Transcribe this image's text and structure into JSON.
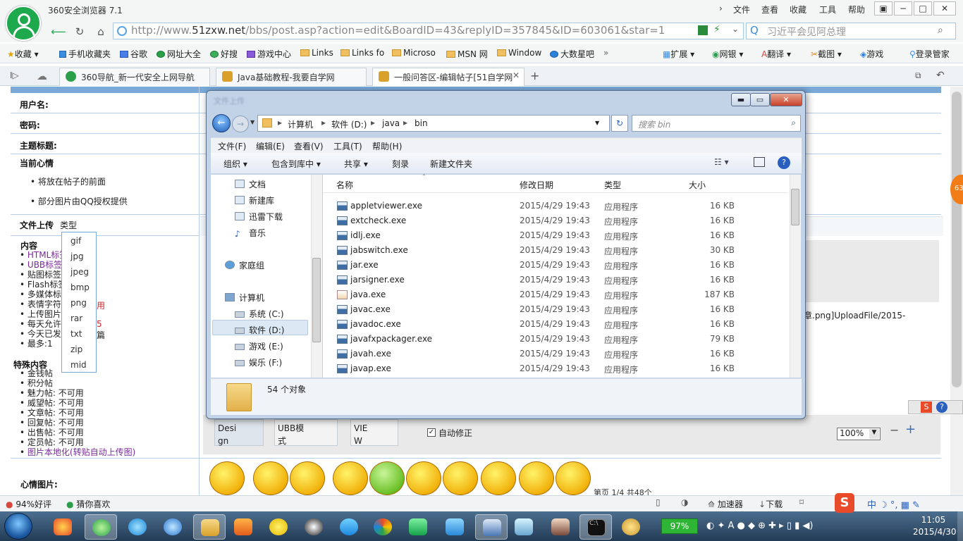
{
  "browser": {
    "title": "360安全浏览器 7.1",
    "menu": [
      "文件",
      "查看",
      "收藏",
      "工具",
      "帮助"
    ],
    "url_prefix": "http://www.",
    "url_domain": "51zxw.net",
    "url_rest": "/bbs/post.asp?action=edit&BoardID=43&replyID=357845&ID=603061&star=1",
    "search_text": "习近平会见阿总理",
    "bookmarks": [
      "收藏",
      "手机收藏夹",
      "谷歌",
      "网址大全",
      "好搜",
      "游戏中心",
      "Links",
      "Links fo",
      "Microso",
      "MSN 网",
      "Window",
      "大数星吧"
    ],
    "tools": [
      "扩展",
      "网银",
      "翻译",
      "截图",
      "游戏",
      "登录管家"
    ],
    "tabs": [
      {
        "label": "360导航_新一代安全上网导航"
      },
      {
        "label": "Java基础教程-我要自学网"
      },
      {
        "label": "一般问答区-编辑帖子[51自学网"
      }
    ]
  },
  "form": {
    "username_label": "用户名:",
    "password_label": "密码:",
    "subject_label": "主题标题:",
    "mood_label": "当前心情",
    "mood_items": [
      "将放在帖子的前面",
      "部分图片由QQ授权提供"
    ],
    "upload_label": "文件上传",
    "upload_type_label": "类型",
    "content_label": "内容",
    "content_items": [
      "HTML标签",
      "UBB标签",
      "贴图标签",
      "Flash标签",
      "多媒体标",
      "表情字符",
      "上传图片",
      "每天允许",
      "今天已发",
      "最多:1"
    ],
    "content_red": "用",
    "content_red2": "5",
    "content_side": "篇",
    "special_label": "特殊内容",
    "special_items": [
      "金钱帖",
      "积分帖",
      "魅力帖: 不可用",
      "威望帖: 不可用",
      "文章帖: 不可用",
      "回复帖: 不可用",
      "出售帖: 不可用",
      "定员帖: 不可用"
    ],
    "special_link": "图片本地化(转贴自动上传图)",
    "mood_pic_label": "心情图片:",
    "upload_text": "章.png]UploadFile/2015-",
    "editor_tabs": [
      "Desi\ngn",
      "UBB模\n式",
      "VIE\nW"
    ],
    "autofix_label": "自动修正",
    "zoom_value": "100%",
    "pager_text": "第页 1/4 共48个"
  },
  "dropdown": {
    "options": [
      "gif",
      "jpg",
      "jpeg",
      "bmp",
      "png",
      "rar",
      "txt",
      "zip",
      "mid"
    ]
  },
  "explorer": {
    "blurred_title": "文件上传",
    "breadcrumb": [
      "计算机",
      "软件 (D:)",
      "java",
      "bin"
    ],
    "search_placeholder": "搜索 bin",
    "menu": [
      "文件(F)",
      "编辑(E)",
      "查看(V)",
      "工具(T)",
      "帮助(H)"
    ],
    "toolbar": [
      "组织",
      "包含到库中",
      "共享",
      "刻录",
      "新建文件夹"
    ],
    "nav": [
      {
        "label": "文档",
        "group": "lib"
      },
      {
        "label": "新建库",
        "group": "lib"
      },
      {
        "label": "迅雷下载",
        "group": "lib"
      },
      {
        "label": "音乐",
        "group": "lib"
      },
      {
        "label": "家庭组",
        "group": "home"
      },
      {
        "label": "计算机",
        "group": "pc"
      },
      {
        "label": "系统 (C:)",
        "group": "drv"
      },
      {
        "label": "软件 (D:)",
        "group": "drv"
      },
      {
        "label": "游戏 (E:)",
        "group": "drv"
      },
      {
        "label": "娱乐 (F:)",
        "group": "drv"
      }
    ],
    "columns": [
      "名称",
      "修改日期",
      "类型",
      "大小"
    ],
    "files": [
      {
        "name": "appletviewer.exe",
        "date": "2015/4/29 19:43",
        "type": "应用程序",
        "size": "16 KB"
      },
      {
        "name": "extcheck.exe",
        "date": "2015/4/29 19:43",
        "type": "应用程序",
        "size": "16 KB"
      },
      {
        "name": "idlj.exe",
        "date": "2015/4/29 19:43",
        "type": "应用程序",
        "size": "16 KB"
      },
      {
        "name": "jabswitch.exe",
        "date": "2015/4/29 19:43",
        "type": "应用程序",
        "size": "30 KB"
      },
      {
        "name": "jar.exe",
        "date": "2015/4/29 19:43",
        "type": "应用程序",
        "size": "16 KB"
      },
      {
        "name": "jarsigner.exe",
        "date": "2015/4/29 19:43",
        "type": "应用程序",
        "size": "16 KB"
      },
      {
        "name": "java.exe",
        "date": "2015/4/29 19:43",
        "type": "应用程序",
        "size": "187 KB"
      },
      {
        "name": "javac.exe",
        "date": "2015/4/29 19:43",
        "type": "应用程序",
        "size": "16 KB"
      },
      {
        "name": "javadoc.exe",
        "date": "2015/4/29 19:43",
        "type": "应用程序",
        "size": "16 KB"
      },
      {
        "name": "javafxpackager.exe",
        "date": "2015/4/29 19:43",
        "type": "应用程序",
        "size": "79 KB"
      },
      {
        "name": "javah.exe",
        "date": "2015/4/29 19:43",
        "type": "应用程序",
        "size": "16 KB"
      },
      {
        "name": "javap.exe",
        "date": "2015/4/29 19:43",
        "type": "应用程序",
        "size": "16 KB"
      }
    ],
    "status": "54 个对象"
  },
  "status_bar": {
    "rating": "94%好评",
    "guess": "猜你喜欢",
    "accel": "加速器",
    "download": "下载"
  },
  "side_badge": "63",
  "taskbar": {
    "battery": "97%",
    "time": "11:05",
    "date": "2015/4/30"
  },
  "colors": {
    "accent": "#3b8de0",
    "brand_green": "#1fa94d",
    "taskbar": "#2a4764"
  }
}
